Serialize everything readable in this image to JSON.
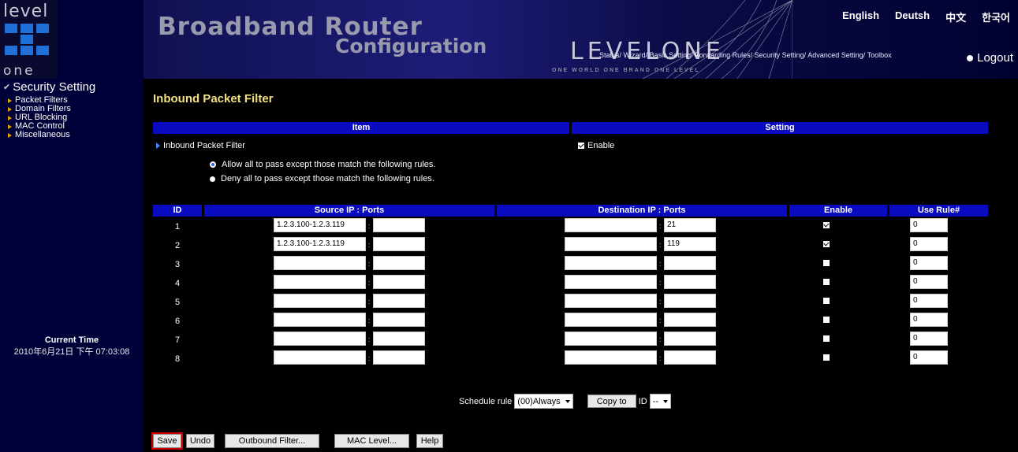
{
  "header": {
    "logo_top": "level",
    "logo_bottom": "one",
    "title_line1": "Broadband Router",
    "title_line2": "Configuration",
    "brand": "LEVELONE",
    "tagline": "ONE WORLD ONE BRAND ONE LEVEL",
    "languages": [
      "English",
      "Deutsh",
      "中文",
      "한국어"
    ],
    "nav": [
      "Status/",
      "Wizard/",
      "Basic Setting/",
      "Forwarding Rules/",
      "Security Setting/",
      "Advanced Setting/",
      "Toolbox"
    ],
    "logout": "Logout"
  },
  "sidebar": {
    "title": "Security Setting",
    "items": [
      "Packet Filters",
      "Domain Filters",
      "URL Blocking",
      "MAC Control",
      "Miscellaneous"
    ],
    "time_label": "Current Time",
    "time_value": "2010年6月21日 下午 07:03:08"
  },
  "main": {
    "title": "Inbound Packet Filter",
    "col_item": "Item",
    "col_setting": "Setting",
    "row_label": "Inbound Packet Filter",
    "enable_label": "Enable",
    "enable_checked": true,
    "radio_allow": "Allow all to pass except those match the following rules.",
    "radio_deny": "Deny all to pass except those match the following rules.",
    "radio_selected": "allow",
    "table_headers": {
      "id": "ID",
      "source": "Source IP : Ports",
      "destination": "Destination IP : Ports",
      "enable": "Enable",
      "use_rule": "Use Rule#"
    },
    "rules": [
      {
        "id": "1",
        "src_ip": "1.2.3.100-1.2.3.119",
        "src_port": "",
        "dst_ip": "",
        "dst_port": "21",
        "enabled": true,
        "use_rule": "0"
      },
      {
        "id": "2",
        "src_ip": "1.2.3.100-1.2.3.119",
        "src_port": "",
        "dst_ip": "",
        "dst_port": "119",
        "enabled": true,
        "use_rule": "0"
      },
      {
        "id": "3",
        "src_ip": "",
        "src_port": "",
        "dst_ip": "",
        "dst_port": "",
        "enabled": false,
        "use_rule": "0"
      },
      {
        "id": "4",
        "src_ip": "",
        "src_port": "",
        "dst_ip": "",
        "dst_port": "",
        "enabled": false,
        "use_rule": "0"
      },
      {
        "id": "5",
        "src_ip": "",
        "src_port": "",
        "dst_ip": "",
        "dst_port": "",
        "enabled": false,
        "use_rule": "0"
      },
      {
        "id": "6",
        "src_ip": "",
        "src_port": "",
        "dst_ip": "",
        "dst_port": "",
        "enabled": false,
        "use_rule": "0"
      },
      {
        "id": "7",
        "src_ip": "",
        "src_port": "",
        "dst_ip": "",
        "dst_port": "",
        "enabled": false,
        "use_rule": "0"
      },
      {
        "id": "8",
        "src_ip": "",
        "src_port": "",
        "dst_ip": "",
        "dst_port": "",
        "enabled": false,
        "use_rule": "0"
      }
    ],
    "schedule_label": "Schedule rule",
    "schedule_value": "(00)Always",
    "copy_to_label": "Copy to",
    "id_label": "ID",
    "id_value": "--",
    "buttons": {
      "save": "Save",
      "undo": "Undo",
      "outbound": "Outbound Filter...",
      "mac_level": "MAC Level...",
      "help": "Help"
    }
  },
  "colors": {
    "header_bg": "#000038",
    "bar_blue": "#0a0ac0",
    "title_yellow": "#f0e080",
    "save_highlight": "#d00000"
  }
}
